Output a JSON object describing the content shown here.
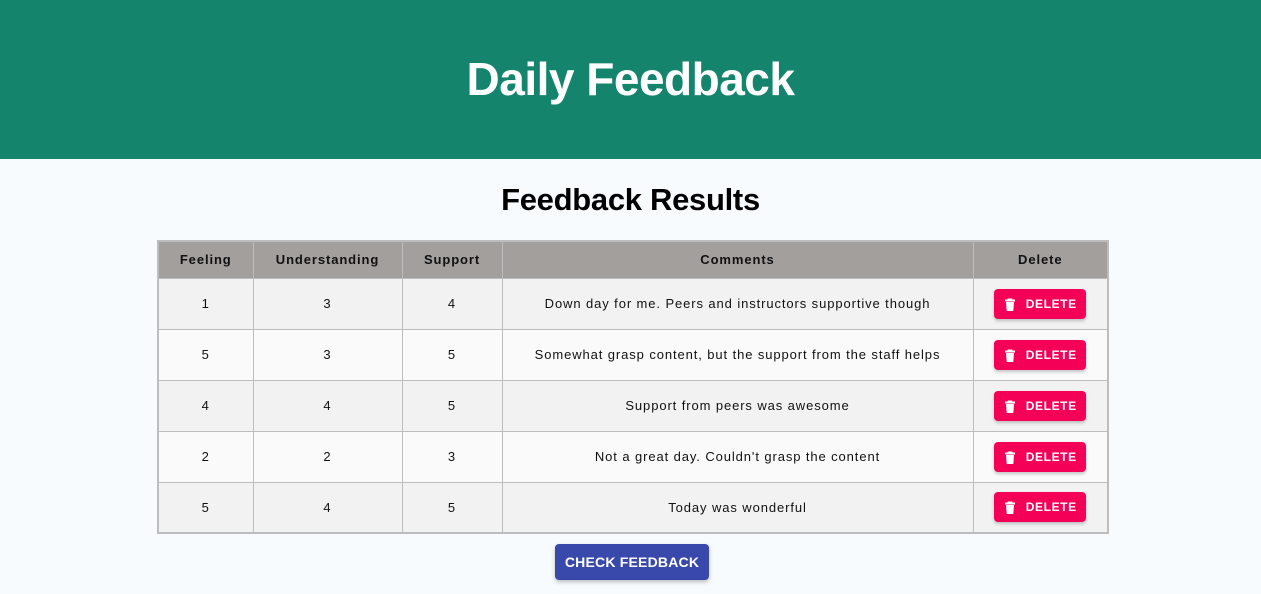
{
  "header": {
    "title": "Daily Feedback",
    "background_color": "#15846d"
  },
  "results": {
    "title": "Feedback Results",
    "columns": [
      "Feeling",
      "Understanding",
      "Support",
      "Comments",
      "Delete"
    ],
    "rows": [
      {
        "feeling": "1",
        "understanding": "3",
        "support": "4",
        "comments": "Down day for me. Peers and instructors supportive though",
        "delete_label": "DELETE"
      },
      {
        "feeling": "5",
        "understanding": "3",
        "support": "5",
        "comments": "Somewhat grasp content, but the support from the staff helps",
        "delete_label": "DELETE"
      },
      {
        "feeling": "4",
        "understanding": "4",
        "support": "5",
        "comments": "Support from peers was awesome",
        "delete_label": "DELETE"
      },
      {
        "feeling": "2",
        "understanding": "2",
        "support": "3",
        "comments": "Not a great day. Couldn't grasp the content",
        "delete_label": "DELETE"
      },
      {
        "feeling": "5",
        "understanding": "4",
        "support": "5",
        "comments": "Today was wonderful",
        "delete_label": "DELETE"
      }
    ],
    "header_color": "#a29f9d",
    "delete_button_color": "#f50057",
    "delete_icon": "trash-icon"
  },
  "actions": {
    "check_feedback_label": "CHECK FEEDBACK",
    "check_feedback_color": "#3949ab"
  }
}
